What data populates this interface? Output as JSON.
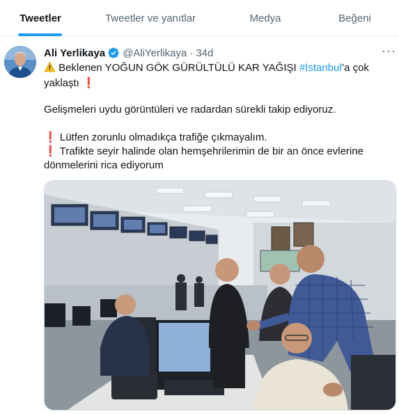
{
  "tabs": [
    {
      "label": "Tweetler",
      "active": true
    },
    {
      "label": "Tweetler ve yanıtlar",
      "active": false
    },
    {
      "label": "Medya",
      "active": false
    },
    {
      "label": "Beğeni",
      "active": false
    }
  ],
  "tweet": {
    "author_name": "Ali Yerlikaya",
    "handle": "@AliYerlikaya",
    "separator": "·",
    "time": "34d",
    "line1_before": "Beklenen YOĞUN GÖK GÜRÜLTÜLÜ KAR YAĞIŞI ",
    "hashtag": "#İstanbul",
    "line1_after": "’a çok",
    "line2": "yaklaştı",
    "para2": "Gelişmeleri uydu görüntüleri ve  radardan sürekli takip ediyoruz.",
    "para3a": "Lütfen zorunlu olmadıkça trafiğe çıkmayalım.",
    "para3b": "Trafikte seyir halinde olan hemşehrilerimin de bir an önce evlerine",
    "para3c": "dönmelerini rica ediyorum",
    "excl": "❗",
    "warning": "⚠️"
  },
  "icons": {
    "verified": "verified-badge-icon",
    "more": "more-dots-icon",
    "warning": "warning-icon",
    "exclamation": "red-exclamation-icon"
  },
  "colors": {
    "accent": "#1d9bf0",
    "text": "#0f1419",
    "secondary": "#536471",
    "exclamation": "#d0103a"
  }
}
